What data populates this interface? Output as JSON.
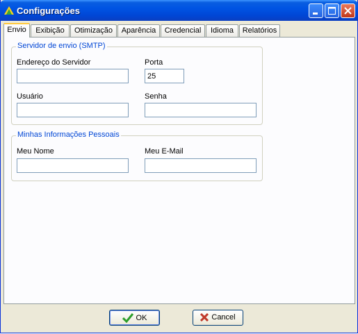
{
  "window": {
    "title": "Configurações"
  },
  "tabs": [
    "Envio",
    "Exibição",
    "Otimização",
    "Aparência",
    "Credencial",
    "Idioma",
    "Relatórios"
  ],
  "smtp": {
    "legend": "Servidor de envio (SMTP)",
    "server_label": "Endereço do Servidor",
    "server_value": "",
    "port_label": "Porta",
    "port_value": "25",
    "user_label": "Usuário",
    "user_value": "",
    "password_label": "Senha",
    "password_value": ""
  },
  "personal": {
    "legend": "Minhas Informações Pessoais",
    "name_label": "Meu Nome",
    "name_value": "",
    "email_label": "Meu E-Mail",
    "email_value": ""
  },
  "buttons": {
    "ok": "OK",
    "cancel": "Cancel"
  },
  "icons": [
    "app-icon",
    "minimize-icon",
    "maximize-icon",
    "close-icon",
    "checkmark-icon",
    "x-icon"
  ],
  "colors": {
    "titlebar": "#0054e3",
    "legend_text": "#0046d5",
    "ok_icon": "#2a9d2a",
    "cancel_icon": "#c0392b"
  }
}
